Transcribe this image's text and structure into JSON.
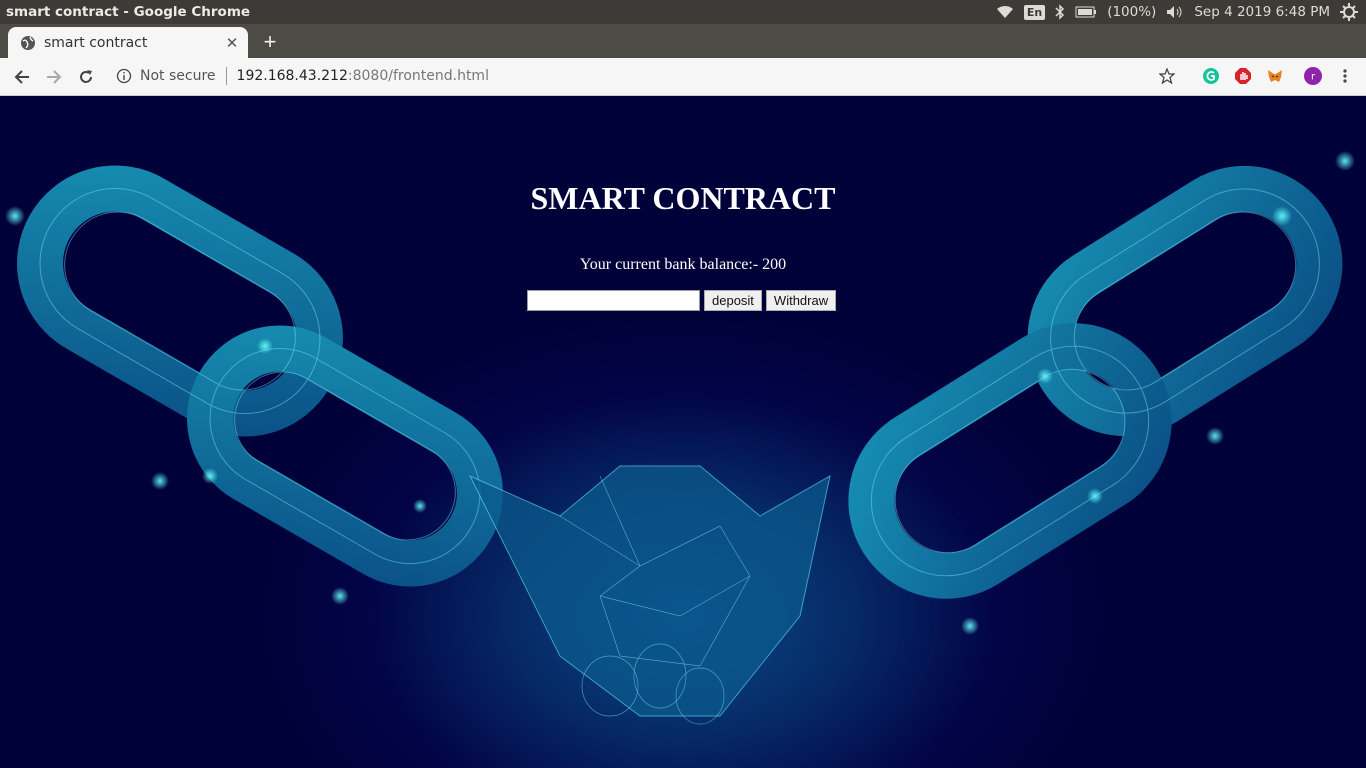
{
  "os": {
    "window_title": "smart contract - Google Chrome",
    "keyboard_lang": "En",
    "battery": "(100%)",
    "datetime": "Sep  4 2019  6:48 PM"
  },
  "browser": {
    "tab_title": "smart contract",
    "security_label": "Not secure",
    "url_host": "192.168.43.212",
    "url_rest": ":8080/frontend.html",
    "profile_initial": "r"
  },
  "page": {
    "title": "SMART CONTRACT",
    "balance_text": "Your current bank balance:- 200",
    "amount_input_value": "",
    "deposit_label": "deposit",
    "withdraw_label": "Withdraw"
  },
  "colors": {
    "background": "#02023a",
    "accent": "#2ec4d6"
  },
  "icons": [
    "wifi-icon",
    "bluetooth-icon",
    "battery-icon",
    "volume-icon",
    "power-gear-icon",
    "globe-icon",
    "close-icon",
    "plus-icon",
    "back-icon",
    "forward-icon",
    "reload-icon",
    "info-icon",
    "star-icon",
    "grammarly-icon",
    "adblock-icon",
    "metamask-icon",
    "profile-avatar",
    "menu-icon"
  ]
}
